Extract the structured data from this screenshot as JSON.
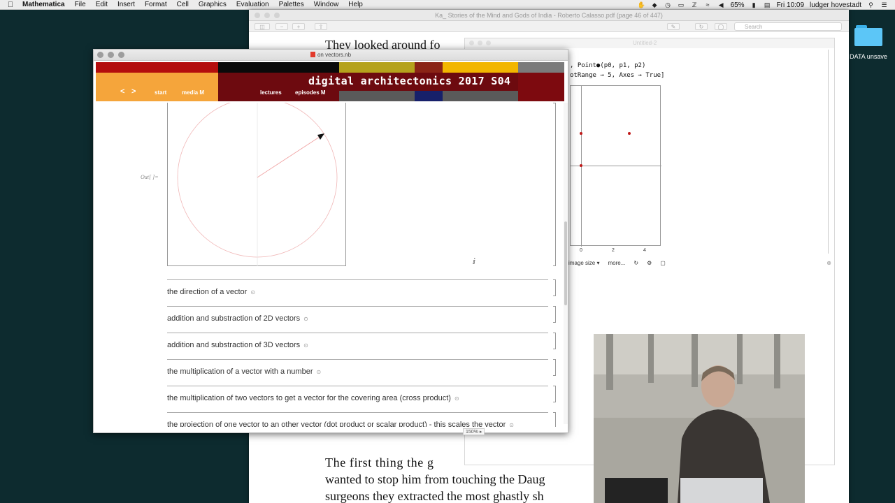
{
  "menubar": {
    "app_name": "Mathematica",
    "menus": [
      "File",
      "Edit",
      "Insert",
      "Format",
      "Cell",
      "Graphics",
      "Evaluation",
      "Palettes",
      "Window",
      "Help"
    ],
    "battery": "65%",
    "clock": "Fri 10:09",
    "user": "ludger hovestadt"
  },
  "desktop": {
    "folder_label": "DATA unsave"
  },
  "pdf_window": {
    "title": "Ka_ Stories of the Mind and Gods of India - Roberto Calasso.pdf (page 46 of 447)",
    "search_placeholder": "Search",
    "text_top": "They looked around fo",
    "text_lines": [
      "The first thing the g",
      "wanted to stop him from touching the Daug",
      "surgeons they extracted the most ghastly sh"
    ]
  },
  "untitled_window": {
    "title": "Untitled-2",
    "code_line1": ", Point●(p0, p1, p2)",
    "code_line2": "otRange → 5, Axes → True]",
    "plot_ticks": [
      "0",
      "2",
      "4"
    ],
    "toolbar": {
      "image_size": "image size ▾",
      "more": "more..."
    }
  },
  "notebook": {
    "title": "on vectors.nb",
    "banner": {
      "title": "digital architectonics 2017 S04",
      "nav_prev": "<",
      "nav_next": ">",
      "start": "start",
      "media": "media M",
      "lectures": "lectures",
      "episodes": "episodes M"
    },
    "out_label": "Out[ ]=",
    "sections": [
      "the direction of a vector",
      "addition and substraction of 2D vectors",
      "addition and substraction of 3D vectors",
      "the multiplication of a vector with a number",
      "the multiplication of two vectors to get a vector for the covering area (cross product)",
      "the projection of one vector to an other vector (dot product or scalar product) - this scales the vector"
    ],
    "zoom": "150% ▸"
  },
  "colors": {
    "banner_red": "#b30d0d",
    "banner_black": "#0a0a0a",
    "banner_olive": "#b5a21c",
    "banner_brown": "#8a2416",
    "banner_gold": "#f2b600",
    "banner_grey": "#7b7b7b",
    "banner_orange": "#f5a53b",
    "banner_maroon": "#6d0a0f",
    "banner_darkgrey": "#5a5a5a",
    "banner_navy": "#17206a",
    "banner_darkred": "#7d0a0f",
    "plot_point": "#c01818",
    "desktop_bg": "#0d2b2f"
  }
}
